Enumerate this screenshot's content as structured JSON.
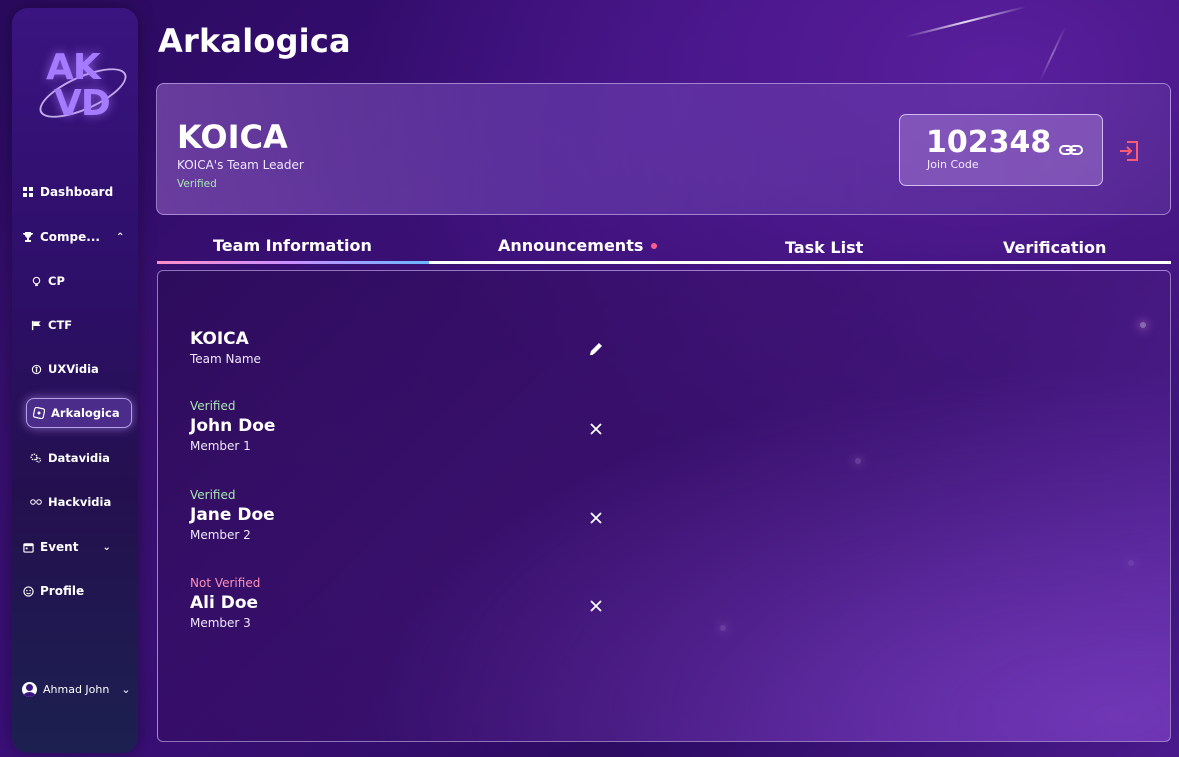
{
  "app": {
    "logo_line1": "AK",
    "logo_line2": "VD",
    "page_title": "Arkalogica"
  },
  "sidebar": {
    "items": [
      {
        "label": "Dashboard",
        "icon": "grid-icon"
      },
      {
        "label": "Compe...",
        "icon": "trophy-icon",
        "expanded": true
      },
      {
        "label": "CP",
        "icon": "bulb-icon"
      },
      {
        "label": "CTF",
        "icon": "flag-icon"
      },
      {
        "label": "UXVidia",
        "icon": "figure-icon"
      },
      {
        "label": "Arkalogica",
        "icon": "puzzle-icon",
        "active": true
      },
      {
        "label": "Datavidia",
        "icon": "gears-icon"
      },
      {
        "label": "Hackvidia",
        "icon": "infinity-icon"
      },
      {
        "label": "Event",
        "icon": "calendar-icon"
      },
      {
        "label": "Profile",
        "icon": "smile-icon"
      }
    ],
    "user": {
      "name": "Ahmad John"
    }
  },
  "team_card": {
    "name": "KOICA",
    "role": "KOICA's Team Leader",
    "status": "Verified",
    "join_code": "102348",
    "join_label": "Join Code"
  },
  "tabs": [
    {
      "label": "Team Information",
      "active": true
    },
    {
      "label": "Announcements",
      "badge_color": "#ff5d8f"
    },
    {
      "label": "Task List"
    },
    {
      "label": "Verification"
    }
  ],
  "team_info": {
    "team_name_value": "KOICA",
    "team_name_label": "Team Name",
    "members": [
      {
        "status": "Verified",
        "name": "John Doe",
        "role": "Member 1"
      },
      {
        "status": "Verified",
        "name": "Jane Doe",
        "role": "Member 2"
      },
      {
        "status": "Not Verified",
        "name": "Ali Doe",
        "role": "Member 3"
      }
    ]
  },
  "colors": {
    "accent_pink": "#ff5d8f",
    "verified_green": "#a8e6b4",
    "not_verified_pink": "#ff8fb8",
    "exit_icon_red": "#ff5a6e"
  }
}
